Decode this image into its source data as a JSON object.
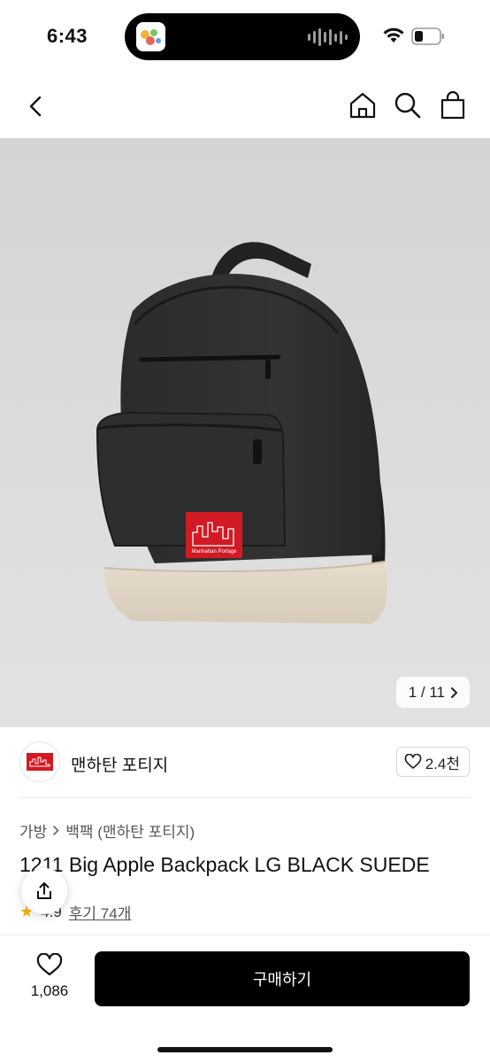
{
  "status_bar": {
    "time": "6:43"
  },
  "image": {
    "counter": "1 / 11",
    "logo_text": "Manhattan Portage"
  },
  "brand": {
    "name": "맨하탄 포티지",
    "likes": "2.4천"
  },
  "breadcrumb": {
    "category": "가방",
    "subcategory": "백팩 (맨하탄 포티지)"
  },
  "product": {
    "title": "1211 Big Apple Backpack LG BLACK SUEDE",
    "rating": "4.9",
    "reviews": "후기 74개"
  },
  "bottom_bar": {
    "wish_count": "1,086",
    "buy_label": "구매하기"
  },
  "colors": {
    "accent": "#000000",
    "star": "#f6b400",
    "patch_red": "#d11a24"
  }
}
